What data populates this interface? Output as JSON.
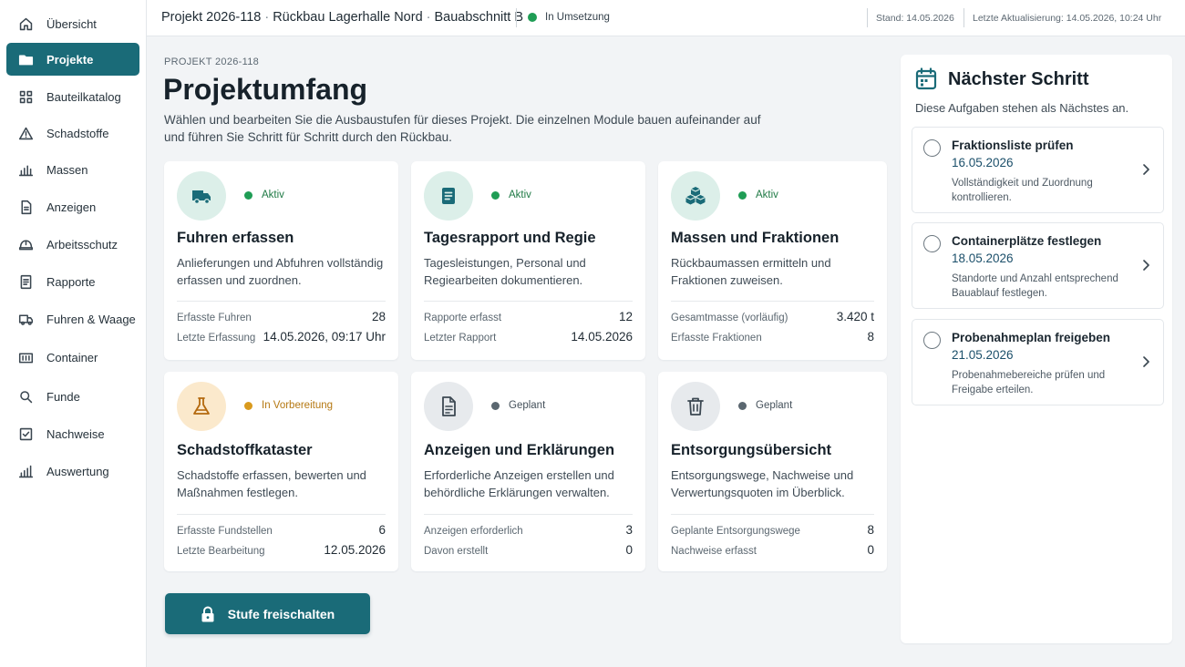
{
  "sidebar": {
    "items": [
      {
        "label": "Übersicht",
        "icon": "home-icon"
      },
      {
        "label": "Projekte",
        "icon": "folder-icon",
        "active": true
      },
      {
        "label": "Bauteilkatalog",
        "icon": "grid-icon"
      },
      {
        "label": "Schadstoffe",
        "icon": "warning-icon"
      },
      {
        "label": "Massen",
        "icon": "bar-chart-icon"
      },
      {
        "label": "Anzeigen",
        "icon": "document-icon"
      },
      {
        "label": "Arbeitsschutz",
        "icon": "helmet-icon"
      },
      {
        "label": "Rapporte",
        "icon": "report-icon"
      },
      {
        "label": "Fuhren & Waage",
        "icon": "truck-icon"
      },
      {
        "label": "Container",
        "icon": "container-icon"
      },
      {
        "label": "Funde",
        "icon": "search-icon"
      },
      {
        "label": "Nachweise",
        "icon": "checkbox-icon"
      },
      {
        "label": "Auswertung",
        "icon": "analytics-icon"
      }
    ]
  },
  "header": {
    "project_id": "Projekt 2026-118",
    "project_name": "Rückbau Lagerhalle Nord",
    "section": "Bauabschnitt B",
    "separator": "·",
    "status": "In Umsetzung",
    "stand": "Stand: 14.05.2026",
    "updated": "Letzte Aktualisierung: 14.05.2026, 10:24 Uhr"
  },
  "main": {
    "eyebrow": "PROJEKT 2026-118",
    "title": "Projektumfang",
    "description": "Wählen und bearbeiten Sie die Ausbaustufen für dieses Projekt. Die einzelnen Module bauen aufeinander auf und führen Sie Schritt für Schritt durch den Rückbau.",
    "cards": [
      {
        "icon": "truck-icon",
        "status": "Aktiv",
        "status_color": "#1f9d55",
        "title": "Fuhren erfassen",
        "description": "Anlieferungen und Abfuhren vollständig erfassen und zuordnen.",
        "rows": [
          {
            "label": "Erfasste Fuhren",
            "value": "28"
          },
          {
            "label": "Letzte Erfassung",
            "value": "14.05.2026, 09:17 Uhr"
          }
        ]
      },
      {
        "icon": "report-icon",
        "status": "Aktiv",
        "status_color": "#1f9d55",
        "title": "Tagesrapport und Regie",
        "description": "Tagesleistungen, Personal und Regiearbeiten dokumentieren.",
        "rows": [
          {
            "label": "Rapporte erfasst",
            "value": "12"
          },
          {
            "label": "Letzter Rapport",
            "value": "14.05.2026"
          }
        ]
      },
      {
        "icon": "boxes-icon",
        "status": "Aktiv",
        "status_color": "#1f9d55",
        "title": "Massen und Fraktionen",
        "description": "Rückbaumassen ermitteln und Fraktionen zuweisen.",
        "rows": [
          {
            "label": "Gesamtmasse (vorläufig)",
            "value": "3.420 t"
          },
          {
            "label": "Erfasste Fraktionen",
            "value": "8"
          }
        ]
      },
      {
        "icon": "flask-icon",
        "status": "In Vorbereitung",
        "status_color": "#d99a1e",
        "title": "Schadstoffkataster",
        "description": "Schadstoffe erfassen, bewerten und Maßnahmen festlegen.",
        "rows": [
          {
            "label": "Erfasste Fundstellen",
            "value": "6"
          },
          {
            "label": "Letzte Bearbeitung",
            "value": "12.05.2026"
          }
        ]
      },
      {
        "icon": "document-icon",
        "status": "Geplant",
        "status_color": "#5b6770",
        "title": "Anzeigen und Erklärungen",
        "description": "Erforderliche Anzeigen erstellen und behördliche Erklärungen verwalten.",
        "rows": [
          {
            "label": "Anzeigen erforderlich",
            "value": "3"
          },
          {
            "label": "Davon erstellt",
            "value": "0"
          }
        ]
      },
      {
        "icon": "trash-icon",
        "status": "Geplant",
        "status_color": "#5b6770",
        "title": "Entsorgungsübersicht",
        "description": "Entsorgungswege, Nachweise und Verwertungsquoten im Überblick.",
        "rows": [
          {
            "label": "Geplante Entsorgungswege",
            "value": "8"
          },
          {
            "label": "Nachweise erfasst",
            "value": "0"
          }
        ]
      }
    ],
    "unlock_button": "Stufe freischalten"
  },
  "next_step": {
    "title": "Nächster Schritt",
    "subtitle": "Diese Aufgaben stehen als Nächstes an.",
    "tasks": [
      {
        "title": "Fraktionsliste prüfen",
        "date": "16.05.2026",
        "note": "Vollständigkeit und Zuordnung kontrollieren."
      },
      {
        "title": "Containerplätze festlegen",
        "date": "18.05.2026",
        "note": "Standorte und Anzahl entsprechend Bauablauf festlegen."
      },
      {
        "title": "Probenahmeplan freigeben",
        "date": "21.05.2026",
        "note": "Probenahmebereiche prüfen und Freigabe erteilen."
      }
    ]
  },
  "colors": {
    "accent": "#1a6b78",
    "active_green": "#1f9d55",
    "prep_amber": "#d99a1e",
    "planned_grey": "#5b6770"
  }
}
